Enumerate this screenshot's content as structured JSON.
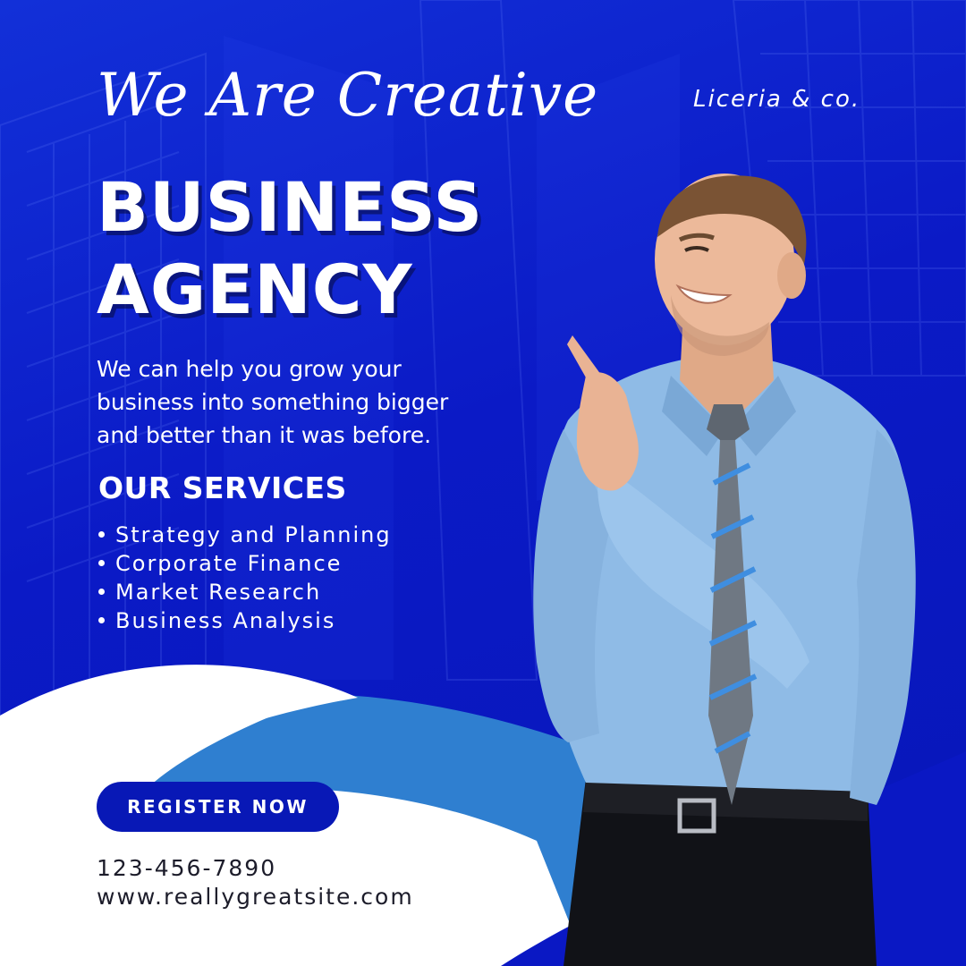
{
  "brand": "Liceria & co.",
  "script_heading": "We Are Creative",
  "headline": {
    "line1": "BUSINESS",
    "line2": "AGENCY"
  },
  "description": "We can help you grow your business into something bigger and better than it was before.",
  "services": {
    "title": "OUR SERVICES",
    "items": [
      "Strategy and Planning",
      "Corporate Finance",
      "Market Research",
      "Business Analysis"
    ]
  },
  "cta": {
    "label": "REGISTER NOW"
  },
  "contact": {
    "phone": "123-456-7890",
    "website": "www.reallygreatsite.com"
  },
  "colors": {
    "primary_blue": "#0b1ac6",
    "accent_blue": "#2f7fd0",
    "button_blue": "#0818b6",
    "white": "#ffffff",
    "shirt_blue": "#8fbbe6"
  }
}
